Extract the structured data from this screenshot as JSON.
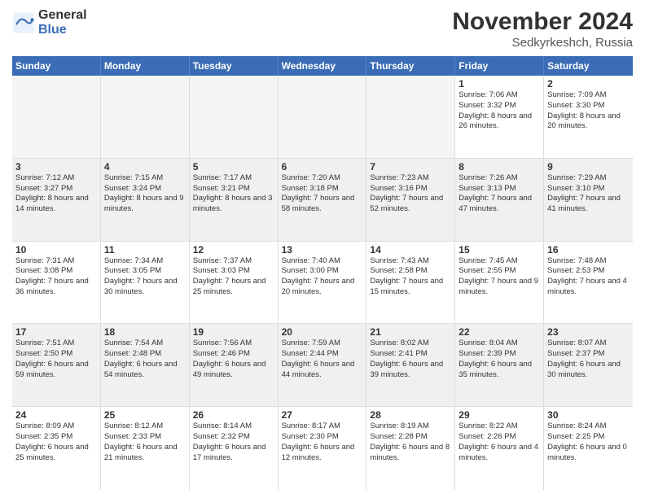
{
  "header": {
    "logo_line1": "General",
    "logo_line2": "Blue",
    "month": "November 2024",
    "location": "Sedkyrkeshch, Russia"
  },
  "days": [
    "Sunday",
    "Monday",
    "Tuesday",
    "Wednesday",
    "Thursday",
    "Friday",
    "Saturday"
  ],
  "rows": [
    [
      {
        "day": "",
        "text": "",
        "empty": true
      },
      {
        "day": "",
        "text": "",
        "empty": true
      },
      {
        "day": "",
        "text": "",
        "empty": true
      },
      {
        "day": "",
        "text": "",
        "empty": true
      },
      {
        "day": "",
        "text": "",
        "empty": true
      },
      {
        "day": "1",
        "text": "Sunrise: 7:06 AM\nSunset: 3:32 PM\nDaylight: 8 hours and 26 minutes.",
        "empty": false
      },
      {
        "day": "2",
        "text": "Sunrise: 7:09 AM\nSunset: 3:30 PM\nDaylight: 8 hours and 20 minutes.",
        "empty": false
      }
    ],
    [
      {
        "day": "3",
        "text": "Sunrise: 7:12 AM\nSunset: 3:27 PM\nDaylight: 8 hours and 14 minutes.",
        "empty": false
      },
      {
        "day": "4",
        "text": "Sunrise: 7:15 AM\nSunset: 3:24 PM\nDaylight: 8 hours and 9 minutes.",
        "empty": false
      },
      {
        "day": "5",
        "text": "Sunrise: 7:17 AM\nSunset: 3:21 PM\nDaylight: 8 hours and 3 minutes.",
        "empty": false
      },
      {
        "day": "6",
        "text": "Sunrise: 7:20 AM\nSunset: 3:18 PM\nDaylight: 7 hours and 58 minutes.",
        "empty": false
      },
      {
        "day": "7",
        "text": "Sunrise: 7:23 AM\nSunset: 3:16 PM\nDaylight: 7 hours and 52 minutes.",
        "empty": false
      },
      {
        "day": "8",
        "text": "Sunrise: 7:26 AM\nSunset: 3:13 PM\nDaylight: 7 hours and 47 minutes.",
        "empty": false
      },
      {
        "day": "9",
        "text": "Sunrise: 7:29 AM\nSunset: 3:10 PM\nDaylight: 7 hours and 41 minutes.",
        "empty": false
      }
    ],
    [
      {
        "day": "10",
        "text": "Sunrise: 7:31 AM\nSunset: 3:08 PM\nDaylight: 7 hours and 36 minutes.",
        "empty": false
      },
      {
        "day": "11",
        "text": "Sunrise: 7:34 AM\nSunset: 3:05 PM\nDaylight: 7 hours and 30 minutes.",
        "empty": false
      },
      {
        "day": "12",
        "text": "Sunrise: 7:37 AM\nSunset: 3:03 PM\nDaylight: 7 hours and 25 minutes.",
        "empty": false
      },
      {
        "day": "13",
        "text": "Sunrise: 7:40 AM\nSunset: 3:00 PM\nDaylight: 7 hours and 20 minutes.",
        "empty": false
      },
      {
        "day": "14",
        "text": "Sunrise: 7:43 AM\nSunset: 2:58 PM\nDaylight: 7 hours and 15 minutes.",
        "empty": false
      },
      {
        "day": "15",
        "text": "Sunrise: 7:45 AM\nSunset: 2:55 PM\nDaylight: 7 hours and 9 minutes.",
        "empty": false
      },
      {
        "day": "16",
        "text": "Sunrise: 7:48 AM\nSunset: 2:53 PM\nDaylight: 7 hours and 4 minutes.",
        "empty": false
      }
    ],
    [
      {
        "day": "17",
        "text": "Sunrise: 7:51 AM\nSunset: 2:50 PM\nDaylight: 6 hours and 59 minutes.",
        "empty": false
      },
      {
        "day": "18",
        "text": "Sunrise: 7:54 AM\nSunset: 2:48 PM\nDaylight: 6 hours and 54 minutes.",
        "empty": false
      },
      {
        "day": "19",
        "text": "Sunrise: 7:56 AM\nSunset: 2:46 PM\nDaylight: 6 hours and 49 minutes.",
        "empty": false
      },
      {
        "day": "20",
        "text": "Sunrise: 7:59 AM\nSunset: 2:44 PM\nDaylight: 6 hours and 44 minutes.",
        "empty": false
      },
      {
        "day": "21",
        "text": "Sunrise: 8:02 AM\nSunset: 2:41 PM\nDaylight: 6 hours and 39 minutes.",
        "empty": false
      },
      {
        "day": "22",
        "text": "Sunrise: 8:04 AM\nSunset: 2:39 PM\nDaylight: 6 hours and 35 minutes.",
        "empty": false
      },
      {
        "day": "23",
        "text": "Sunrise: 8:07 AM\nSunset: 2:37 PM\nDaylight: 6 hours and 30 minutes.",
        "empty": false
      }
    ],
    [
      {
        "day": "24",
        "text": "Sunrise: 8:09 AM\nSunset: 2:35 PM\nDaylight: 6 hours and 25 minutes.",
        "empty": false
      },
      {
        "day": "25",
        "text": "Sunrise: 8:12 AM\nSunset: 2:33 PM\nDaylight: 6 hours and 21 minutes.",
        "empty": false
      },
      {
        "day": "26",
        "text": "Sunrise: 8:14 AM\nSunset: 2:32 PM\nDaylight: 6 hours and 17 minutes.",
        "empty": false
      },
      {
        "day": "27",
        "text": "Sunrise: 8:17 AM\nSunset: 2:30 PM\nDaylight: 6 hours and 12 minutes.",
        "empty": false
      },
      {
        "day": "28",
        "text": "Sunrise: 8:19 AM\nSunset: 2:28 PM\nDaylight: 6 hours and 8 minutes.",
        "empty": false
      },
      {
        "day": "29",
        "text": "Sunrise: 8:22 AM\nSunset: 2:26 PM\nDaylight: 6 hours and 4 minutes.",
        "empty": false
      },
      {
        "day": "30",
        "text": "Sunrise: 8:24 AM\nSunset: 2:25 PM\nDaylight: 6 hours and 0 minutes.",
        "empty": false
      }
    ]
  ]
}
